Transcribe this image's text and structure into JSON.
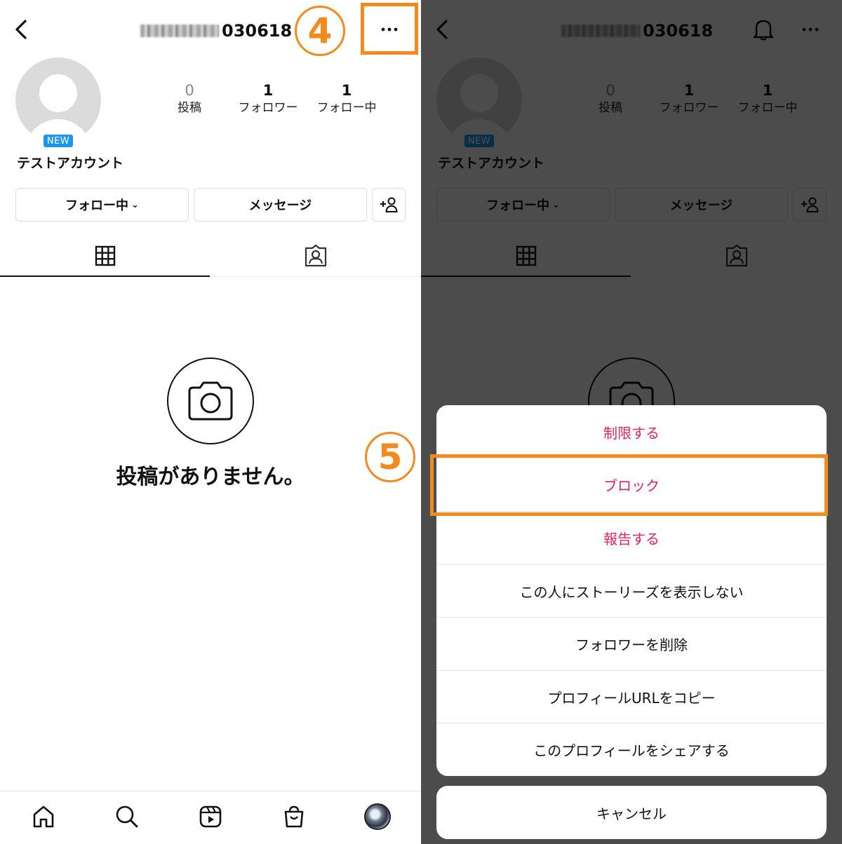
{
  "header": {
    "username_suffix": "030618",
    "more_icon": "more-horizontal-icon",
    "back_icon": "chevron-left-icon",
    "bell_icon": "bell-icon"
  },
  "profile": {
    "new_badge": "NEW",
    "display_name": "テストアカウント",
    "stats": [
      {
        "value": "0",
        "label": "投稿"
      },
      {
        "value": "1",
        "label": "フォロワー"
      },
      {
        "value": "1",
        "label": "フォロー中"
      }
    ]
  },
  "actions": {
    "following": "フォロー中",
    "message": "メッセージ",
    "add_user_icon": "add-person-icon"
  },
  "tabs": [
    {
      "icon": "grid-icon",
      "active": true
    },
    {
      "icon": "tagged-person-icon",
      "active": false
    }
  ],
  "empty_state": {
    "icon": "camera-icon",
    "text": "投稿がありません。"
  },
  "bottom_nav": [
    {
      "icon": "home-icon"
    },
    {
      "icon": "search-icon"
    },
    {
      "icon": "reels-icon"
    },
    {
      "icon": "shop-icon"
    },
    {
      "icon": "profile-avatar"
    }
  ],
  "annotations": {
    "step4": "4",
    "step5": "5",
    "color": "#f28a1e"
  },
  "menu": {
    "items": [
      {
        "label": "制限する",
        "destructive": true
      },
      {
        "label": "ブロック",
        "destructive": true
      },
      {
        "label": "報告する",
        "destructive": true
      },
      {
        "label": "この人にストーリーズを表示しない",
        "destructive": false
      },
      {
        "label": "フォロワーを削除",
        "destructive": false
      },
      {
        "label": "プロフィールURLをコピー",
        "destructive": false
      },
      {
        "label": "このプロフィールをシェアする",
        "destructive": false
      }
    ],
    "cancel": "キャンセル"
  },
  "colors": {
    "destructive": "#e0245e",
    "badge": "#1c96ec",
    "highlight": "#f28a1e"
  }
}
